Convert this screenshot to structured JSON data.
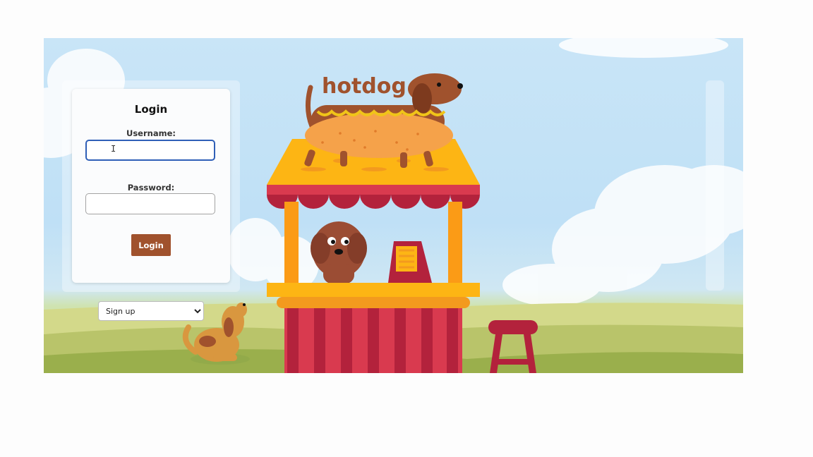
{
  "login": {
    "title": "Login",
    "username_label": "Username:",
    "username_value": "",
    "password_label": "Password:",
    "password_value": "",
    "button_label": "Login"
  },
  "signup": {
    "selected": "Sign up"
  },
  "scene": {
    "logo_text": "hotdog"
  },
  "colors": {
    "login_button": "#a0522d",
    "focus_border": "#2f5fb7",
    "stand_yellow": "#fdb514",
    "stand_red": "#d93a4f",
    "sky": "#c2e1f6"
  }
}
